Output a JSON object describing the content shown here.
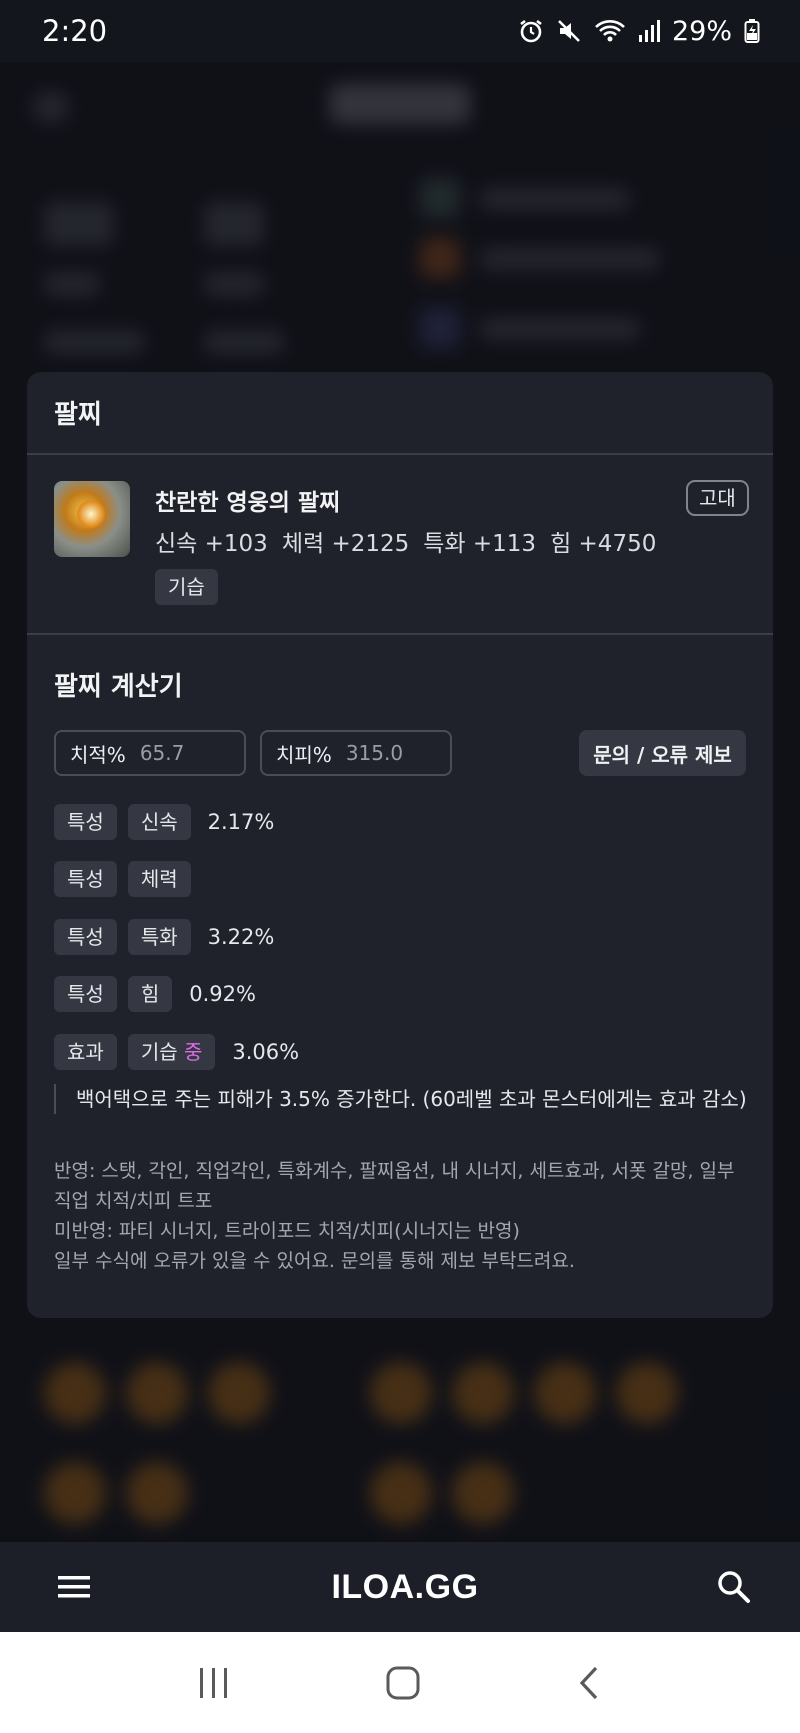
{
  "status_bar": {
    "time": "2:20",
    "battery": "29%",
    "icons": [
      "alarm-icon",
      "mute-icon",
      "wifi-icon",
      "signal-icon",
      "battery-icon"
    ]
  },
  "panel": {
    "title": "팔찌",
    "item": {
      "name": "찬란한 영웅의 팔찌",
      "grade": "고대",
      "stats": [
        "신속 +103",
        "체력 +2125",
        "특화 +113",
        "힘 +4750"
      ],
      "tag": "기습"
    },
    "calculator": {
      "title": "팔찌 계산기",
      "crit_rate": {
        "label": "치적%",
        "value": "65.7"
      },
      "crit_damage": {
        "label": "치피%",
        "value": "315.0"
      },
      "report_button": "문의 / 오류 제보",
      "rows": [
        {
          "kind": "특성",
          "name": "신속",
          "level": "",
          "percent": "2.17%"
        },
        {
          "kind": "특성",
          "name": "체력",
          "level": "",
          "percent": ""
        },
        {
          "kind": "특성",
          "name": "특화",
          "level": "",
          "percent": "3.22%"
        },
        {
          "kind": "특성",
          "name": "힘",
          "level": "",
          "percent": "0.92%"
        },
        {
          "kind": "효과",
          "name": "기습",
          "level": "중",
          "percent": "3.06%"
        }
      ],
      "effect_description": "백어택으로 주는 피해가 3.5% 증가한다. (60레벨 초과 몬스터에게는 효과 감소)",
      "notes": [
        "반영: 스탯, 각인, 직업각인, 특화계수, 팔찌옵션, 내 시너지, 세트효과, 서폿 갈망, 일부 직업 치적/치피 트포",
        "미반영: 파티 시너지, 트라이포드 치적/치피(시너지는 반영)",
        "일부 수식에 오류가 있을 수 있어요. 문의를 통해 제보 부탁드려요."
      ]
    }
  },
  "app_nav": {
    "brand": "ILOA.GG",
    "menu_icon": "hamburger-menu-icon",
    "search_icon": "search-icon"
  },
  "system_nav": {
    "icons": [
      "recent-apps-icon",
      "home-icon",
      "back-icon"
    ]
  },
  "colors": {
    "background": "#14161d",
    "panel": "#1f222b",
    "tag": "#353843",
    "level_accent": "#d96ee6"
  }
}
